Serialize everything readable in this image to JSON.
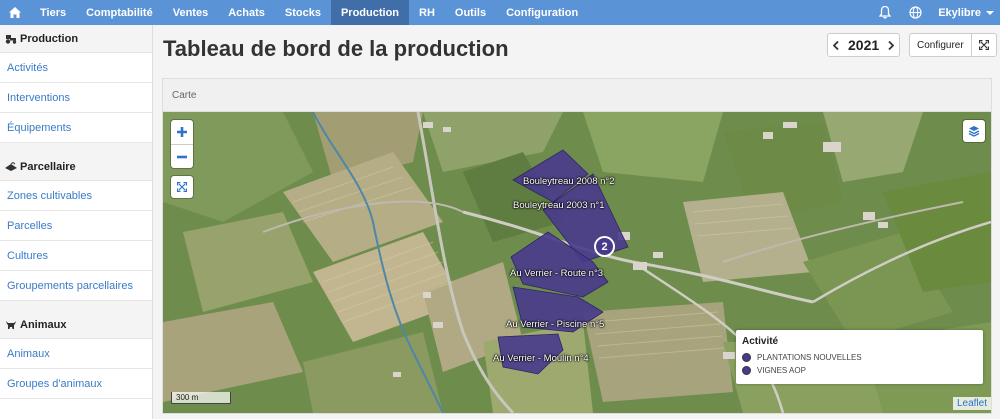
{
  "nav": {
    "items": [
      "Tiers",
      "Comptabilité",
      "Ventes",
      "Achats",
      "Stocks",
      "Production",
      "RH",
      "Outils",
      "Configuration"
    ],
    "active": "Production",
    "user": "Ekylibre",
    "icons": [
      "home-icon",
      "bell-icon",
      "globe-icon"
    ]
  },
  "sidebar": {
    "sections": [
      {
        "title": "Production",
        "icon": "tractor-icon",
        "items": [
          "Activités",
          "Interventions",
          "Équipements"
        ]
      },
      {
        "title": "Parcellaire",
        "icon": "field-icon",
        "items": [
          "Zones cultivables",
          "Parcelles",
          "Cultures",
          "Groupements parcellaires"
        ]
      },
      {
        "title": "Animaux",
        "icon": "cow-icon",
        "items": [
          "Animaux",
          "Groupes d'animaux"
        ]
      }
    ]
  },
  "page": {
    "title": "Tableau de bord de la production",
    "year": "2021",
    "configure_label": "Configurer"
  },
  "map_card": {
    "title": "Carte",
    "plots": [
      "Bouleytreau 2008 n°2",
      "Bouleytreau 2003 n°1",
      "Au Verrier - Route n°3",
      "Au Verrier - Piscine n°5",
      "Au Verrier - Moulin n°4"
    ],
    "cluster_count": "2",
    "legend": {
      "title": "Activité",
      "items": [
        {
          "label": "PLANTATIONS NOUVELLES",
          "color": "#483a8c"
        },
        {
          "label": "VIGNES AOP",
          "color": "#483a8c"
        }
      ]
    },
    "scale": "300 m",
    "attribution": "Leaflet"
  }
}
